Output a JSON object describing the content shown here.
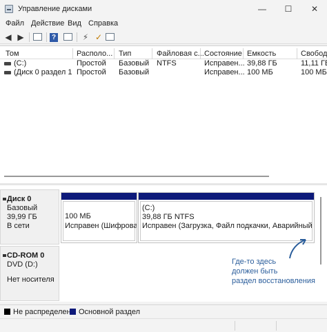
{
  "window": {
    "title": "Управление дисками",
    "controls": {
      "minimize": "—",
      "maximize": "☐",
      "close": "✕"
    }
  },
  "menu": [
    "Файл",
    "Действие",
    "Вид",
    "Справка"
  ],
  "toolbar_icons": [
    "back-arrow-icon",
    "forward-arrow-icon",
    "grid-view-icon",
    "help-icon",
    "properties-icon",
    "connect-icon",
    "check-icon",
    "list-icon"
  ],
  "volume_list": {
    "columns": [
      "Том",
      "Располо...",
      "Тип",
      "Файловая с...",
      "Состояние",
      "Емкость",
      "Свобод..."
    ],
    "rows": [
      [
        "(C:)",
        "Простой",
        "Базовый",
        "NTFS",
        "Исправен...",
        "39,88 ГБ",
        "11,11 ГБ"
      ],
      [
        "(Диск 0 раздел 1)",
        "Простой",
        "Базовый",
        "",
        "Исправен...",
        "100 МБ",
        "100 МБ"
      ]
    ]
  },
  "disks": [
    {
      "name": "Диск 0",
      "type": "Базовый",
      "size": "39,99 ГБ",
      "state": "В сети",
      "partitions": [
        {
          "line1": "100 МБ",
          "line2": "Исправен (Шифрованный",
          "line0": ""
        },
        {
          "line0": "(C:)",
          "line1": "39,88 ГБ NTFS",
          "line2": "Исправен (Загрузка, Файл подкачки, Аварийный дамп"
        }
      ]
    },
    {
      "name": "CD-ROM 0",
      "type": "DVD (D:)",
      "size": "",
      "state": "Нет носителя"
    }
  ],
  "annotation": [
    "Где-то здесь",
    "должен быть",
    "раздел восстановления"
  ],
  "legend": [
    {
      "label": "Не распределена",
      "color": "#000000"
    },
    {
      "label": "Основной раздел",
      "color": "#0d1a7a"
    }
  ],
  "colors": {
    "primary_partition": "#0d1a7a",
    "annotation": "#2a5d9b"
  }
}
